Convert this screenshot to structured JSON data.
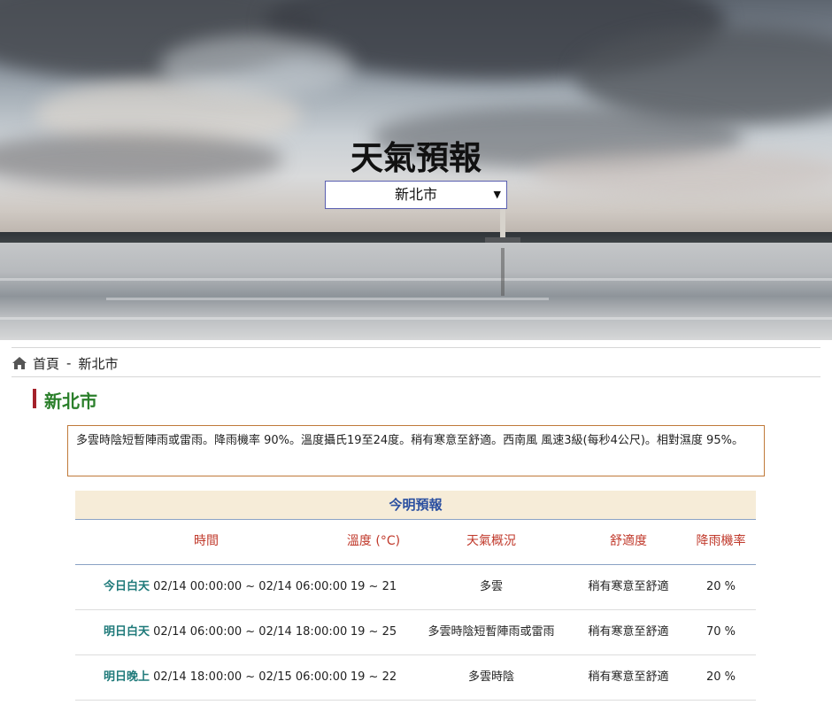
{
  "hero": {
    "title": "天氣預報",
    "selected_city": "新北市",
    "select_arrow": "▼"
  },
  "breadcrumb": {
    "home_icon": "home-icon",
    "home_label": "首頁",
    "separator": "-",
    "current": "新北市"
  },
  "heading": "新北市",
  "summary": "多雲時陰短暫陣雨或雷雨。降雨機率 90%。溫度攝氏19至24度。稍有寒意至舒適。西南風 風速3級(每秒4公尺)。相對濕度 95%。",
  "forecast": {
    "title": "今明預報",
    "columns": [
      "時間",
      "溫度 (°C)",
      "天氣概況",
      "舒適度",
      "降雨機率"
    ],
    "rows": [
      {
        "label": "今日白天",
        "range": "02/14 00:00:00 ~ 02/14 06:00:00",
        "temp": "19 ~ 21",
        "weather": "多雲",
        "comfort": "稍有寒意至舒適",
        "rain": "20 %"
      },
      {
        "label": "明日白天",
        "range": "02/14 06:00:00 ~ 02/14 18:00:00",
        "temp": "19 ~ 25",
        "weather": "多雲時陰短暫陣雨或雷雨",
        "comfort": "稍有寒意至舒適",
        "rain": "70 %"
      },
      {
        "label": "明日晚上",
        "range": "02/14 18:00:00 ~ 02/15 06:00:00",
        "temp": "19 ~ 22",
        "weather": "多雲時陰",
        "comfort": "稍有寒意至舒適",
        "rain": "20 %"
      }
    ]
  },
  "colors": {
    "heading_green": "#2a7f2a",
    "accent_red": "#a4212a",
    "column_header_red": "#c0392b",
    "period_teal": "#1f7a7a",
    "table_title_blue": "#2a4fa0",
    "table_title_bg": "#f6ecd8",
    "summary_border": "#c07a3a"
  }
}
